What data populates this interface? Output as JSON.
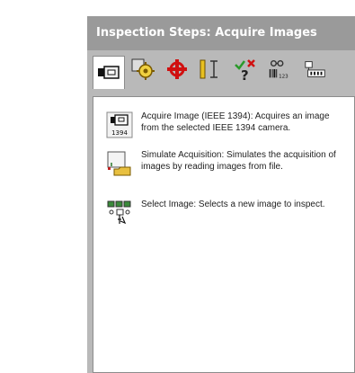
{
  "window": {
    "title": "Inspection Steps: Acquire Images"
  },
  "tabs": [
    {
      "icon": "camera-icon",
      "selected": true
    },
    {
      "icon": "gear-sparkle-icon"
    },
    {
      "icon": "crosshair-target-icon"
    },
    {
      "icon": "caliper-measure-icon"
    },
    {
      "icon": "check-cross-question-icon"
    },
    {
      "icon": "barcode-ocr-icon"
    },
    {
      "icon": "io-device-icon"
    }
  ],
  "steps": [
    {
      "icon": "acquire-ieee1394-icon",
      "icon_label": "1394",
      "text": "Acquire Image (IEEE 1394):  Acquires an image from the selected IEEE 1394 camera."
    },
    {
      "icon": "simulate-acquisition-icon",
      "text": "Simulate Acquisition:  Simulates the acquisition of images by reading images from file."
    },
    {
      "icon": "select-image-icon",
      "text": "Select Image:  Selects a new image to inspect."
    }
  ],
  "colors": {
    "panel_bg": "#b9b9b9",
    "title_bg": "#9a9a9a",
    "content_bg": "#ffffff"
  }
}
